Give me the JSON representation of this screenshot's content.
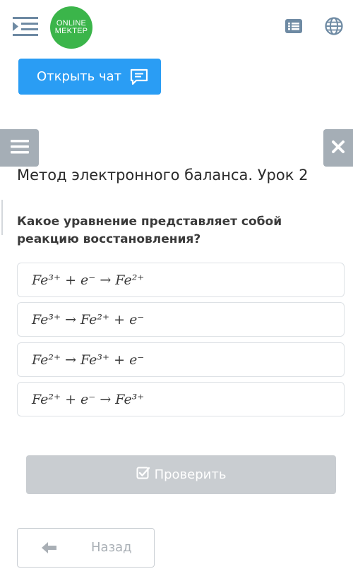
{
  "header": {
    "logo_line1": "ONLINE",
    "logo_line2": "MEKTEP",
    "icons": [
      "menu-toggle-icon",
      "list-icon",
      "globe-icon"
    ]
  },
  "chat_button": {
    "label": "Открыть чат",
    "icon": "chat-icon"
  },
  "side_buttons": {
    "open_icon": "hamburger-icon",
    "close_icon": "close-icon"
  },
  "lesson": {
    "title": "Метод электронного баланса. Урок 2"
  },
  "question": {
    "text": "Какое уравнение представляет собой реакцию восстановления?"
  },
  "options": [
    {
      "text": "Fe³⁺ + e⁻ → Fe²⁺"
    },
    {
      "text": "Fe³⁺ → Fe²⁺ + e⁻"
    },
    {
      "text": "Fe²⁺ → Fe³⁺ + e⁻"
    },
    {
      "text": "Fe²⁺ + e⁻ → Fe³⁺"
    }
  ],
  "check_button": {
    "label": "Проверить",
    "icon": "check-square-icon"
  },
  "back_button": {
    "label": "Назад",
    "icon": "arrow-left-icon"
  },
  "colors": {
    "brand_green": "#3bb54a",
    "chat_blue": "#2a9df4",
    "side_gray": "#a5aeb6",
    "disabled_gray": "#c9cdd1",
    "icon_blue_gray": "#6e8aa3"
  }
}
